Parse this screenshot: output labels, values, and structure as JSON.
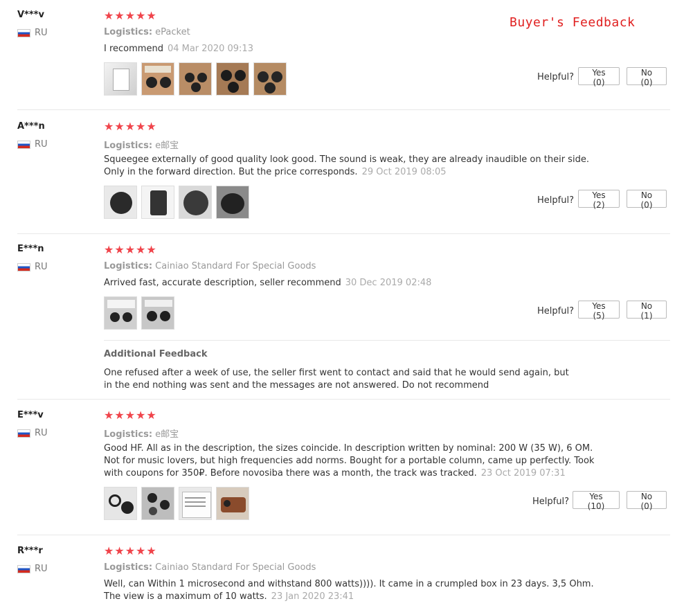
{
  "header": {
    "title": "Buyer's Feedback"
  },
  "helpful_label": "Helpful?",
  "reviews": [
    {
      "name": "V***v",
      "country": "RU",
      "stars": "★★★★★",
      "logistics_label": "Logistics:",
      "logistics": "ePacket",
      "text": "I recommend",
      "date": "04 Mar 2020 09:13",
      "yes": "Yes (0)",
      "no": "No (0)"
    },
    {
      "name": "A***n",
      "country": "RU",
      "stars": "★★★★★",
      "logistics_label": "Logistics:",
      "logistics": "e邮宝",
      "text": "Squeegee externally of good quality look good. The sound is weak, they are already inaudible on their side. Only in the forward direction. But the price corresponds.",
      "date": "29 Oct 2019 08:05",
      "yes": "Yes (2)",
      "no": "No (0)"
    },
    {
      "name": "E***n",
      "country": "RU",
      "stars": "★★★★★",
      "logistics_label": "Logistics:",
      "logistics": "Cainiao Standard For Special Goods",
      "text": "Arrived fast, accurate description, seller recommend",
      "date": "30 Dec 2019 02:48",
      "yes": "Yes (5)",
      "no": "No (1)",
      "additional_title": "Additional Feedback",
      "additional_text": "One refused after a week of use, the seller first went to contact and said that he would send again, but in the end nothing was sent and the messages are not answered. Do not recommend"
    },
    {
      "name": "E***v",
      "country": "RU",
      "stars": "★★★★★",
      "logistics_label": "Logistics:",
      "logistics": "e邮宝",
      "text": "Good HF. All as in the description, the sizes coincide. In description written by nominal: 200 W (35 W), 6 OM. Not for music lovers, but high frequencies add norms. Bought for a portable column, came up perfectly. Took with coupons for 350₽. Before novosiba there was a month, the track was tracked.",
      "date": "23 Oct 2019 07:31",
      "yes": "Yes (10)",
      "no": "No (0)"
    },
    {
      "name": "R***r",
      "country": "RU",
      "stars": "★★★★★",
      "logistics_label": "Logistics:",
      "logistics": "Cainiao Standard For Special Goods",
      "text": "Well, can Within 1 microsecond and withstand 800 watts)))). It came in a crumpled box in 23 days. 3,5 Ohm. The view is a maximum of 10 watts.",
      "date": "23 Jan 2020 23:41"
    }
  ]
}
